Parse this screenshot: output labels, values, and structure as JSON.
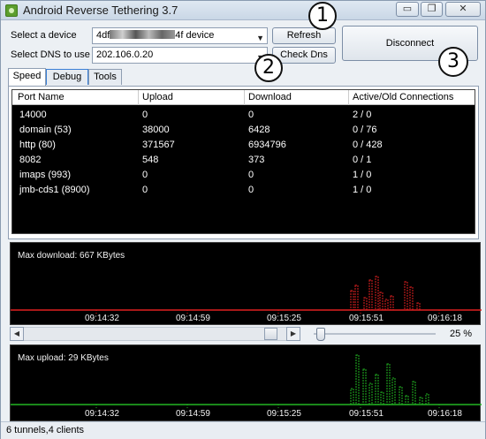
{
  "window": {
    "title": "Android Reverse Tethering 3.7",
    "minimize_glyph": "▭",
    "restore_glyph": "❐",
    "close_glyph": "✕"
  },
  "controls": {
    "device_label": "Select a device",
    "device_value_prefix": "4df",
    "device_value_suffix": "4f  device",
    "dns_label": "Select DNS to use",
    "dns_value": "202.106.0.20",
    "refresh_label": "Refresh",
    "check_dns_label": "Check Dns",
    "disconnect_label": "Disconnect"
  },
  "tabs": [
    "Speed",
    "Debug",
    "Tools"
  ],
  "connections_table": {
    "columns": [
      "Port Name",
      "Upload",
      "Download",
      "Active/Old Connections"
    ],
    "rows": [
      [
        "14000",
        "0",
        "0",
        "2 / 0"
      ],
      [
        "domain (53)",
        "38000",
        "6428",
        "0 / 76"
      ],
      [
        "http (80)",
        "371567",
        "6934796",
        "0 / 428"
      ],
      [
        "8082",
        "548",
        "373",
        "0 / 1"
      ],
      [
        "imaps (993)",
        "0",
        "0",
        "1 / 0"
      ],
      [
        "jmb-cds1 (8900)",
        "0",
        "0",
        "1 / 0"
      ]
    ]
  },
  "download_graph": {
    "label": "Max download: 667 KBytes",
    "color": "#e02020",
    "ticks": [
      "09:14:32",
      "09:14:59",
      "09:15:25",
      "09:15:51",
      "09:16:18"
    ]
  },
  "zoom": {
    "value_text": "25 %",
    "level_percent": 25
  },
  "upload_graph": {
    "label": "Max upload: 29 KBytes",
    "color": "#22b522",
    "ticks": [
      "09:14:32",
      "09:14:59",
      "09:15:25",
      "09:15:51",
      "09:16:18"
    ]
  },
  "status_text": "6 tunnels,4 clients",
  "callouts": [
    "1",
    "2",
    "3"
  ]
}
